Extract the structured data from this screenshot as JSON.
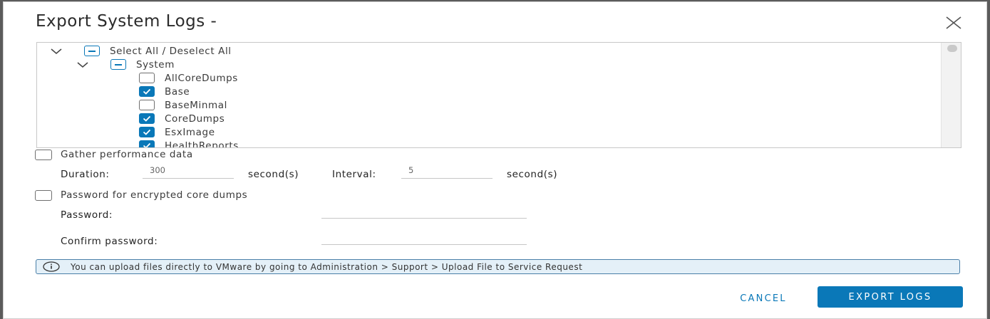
{
  "dialog": {
    "title": "Export System Logs -",
    "close_icon": "close-icon"
  },
  "tree": {
    "root": {
      "label": "Select All / Deselect All",
      "state": "partial",
      "expanded": true
    },
    "group": {
      "label": "System",
      "state": "partial",
      "expanded": true
    },
    "items": [
      {
        "label": "AllCoreDumps",
        "checked": false
      },
      {
        "label": "Base",
        "checked": true
      },
      {
        "label": "BaseMinmal",
        "checked": false
      },
      {
        "label": "CoreDumps",
        "checked": true
      },
      {
        "label": "EsxImage",
        "checked": true
      },
      {
        "label": "HealthReports",
        "checked": true
      }
    ]
  },
  "performance": {
    "label": "Gather performance data",
    "checked": false,
    "duration_label": "Duration:",
    "duration_value": "300",
    "duration_unit": "second(s)",
    "interval_label": "Interval:",
    "interval_value": "5",
    "interval_unit": "second(s)"
  },
  "password": {
    "label": "Password for encrypted core dumps",
    "checked": false,
    "password_label": "Password:",
    "password_value": "",
    "confirm_label": "Confirm password:",
    "confirm_value": ""
  },
  "info": {
    "icon": "info-icon",
    "text": "You can upload files directly to VMware by going to Administration > Support > Upload File to Service Request"
  },
  "buttons": {
    "cancel": "CANCEL",
    "export": "EXPORT LOGS"
  },
  "colors": {
    "accent": "#0a78b8",
    "info_border": "#4a7fa8",
    "info_background": "#e4f0f8"
  }
}
